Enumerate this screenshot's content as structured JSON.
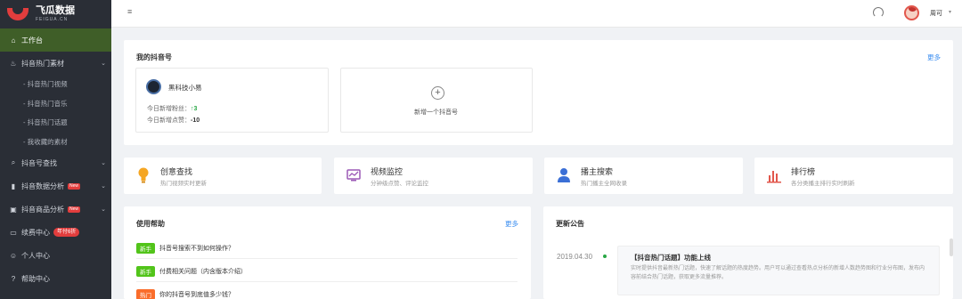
{
  "brand": {
    "name_cn": "飞瓜数据",
    "name_en": "FEIGUA.CN"
  },
  "sidebar": {
    "items": [
      {
        "label": "工作台",
        "icon": "home-icon"
      },
      {
        "label": "抖音热门素材",
        "icon": "fire-icon"
      },
      {
        "label": "抖音号查找",
        "icon": "search-icon"
      },
      {
        "label": "抖音数据分析",
        "icon": "bar-chart-icon",
        "badge": "New"
      },
      {
        "label": "抖音商品分析",
        "icon": "shop-icon",
        "badge": "New"
      },
      {
        "label": "续费中心",
        "icon": "card-icon",
        "badge": "年付6折"
      },
      {
        "label": "个人中心",
        "icon": "user-icon"
      },
      {
        "label": "帮助中心",
        "icon": "help-icon"
      }
    ],
    "submenu": [
      "- 抖音热门视频",
      "- 抖音热门音乐",
      "- 抖音热门话题",
      "- 我收藏的素材"
    ]
  },
  "topbar": {
    "menu_glyph": "≡",
    "username": "周可",
    "caret": "▾"
  },
  "my_accounts": {
    "title": "我的抖音号",
    "more": "更多",
    "account": {
      "name": "黑科技小易",
      "fans_label": "今日新增粉丝：",
      "fans_arrow": "↑",
      "fans_value": "3",
      "likes_label": "今日新增点赞：",
      "likes_value": "-10"
    },
    "add_label": "新增一个抖音号",
    "add_glyph": "+"
  },
  "tools": [
    {
      "title": "创意查找",
      "desc": "热门视频实时更新",
      "icon": "lightbulb-icon",
      "color": "#f5a623"
    },
    {
      "title": "视频监控",
      "desc": "分钟级点赞、评论监控",
      "icon": "monitor-icon",
      "color": "#9b59b6"
    },
    {
      "title": "播主搜索",
      "desc": "热门播主全网收录",
      "icon": "person-icon",
      "color": "#3b6fd6"
    },
    {
      "title": "排行榜",
      "desc": "各分类播主排行实时刷新",
      "icon": "ranking-icon",
      "color": "#e2574c"
    }
  ],
  "help": {
    "title": "使用帮助",
    "more": "更多",
    "rows": [
      {
        "tag": "新手",
        "tag_color": "#52c41a",
        "text": "抖音号搜索不到如何操作？"
      },
      {
        "tag": "新手",
        "tag_color": "#52c41a",
        "text": "付费相关问题（内含版本介绍）"
      },
      {
        "tag": "热门",
        "tag_color": "#fa6d2b",
        "text": "你的抖音号到底值多少钱？"
      }
    ]
  },
  "announcements": {
    "title": "更新公告",
    "items": [
      {
        "date": "2019.04.30",
        "title": "【抖音热门话题】功能上线",
        "body": "实时提供抖音最新热门话题，快速了解话题的热度趋势。用户可以通过查看热点分析的新增人数趋势图和行业分布图，发布内容前结合热门话题，获取更多流量推荐。"
      }
    ]
  }
}
